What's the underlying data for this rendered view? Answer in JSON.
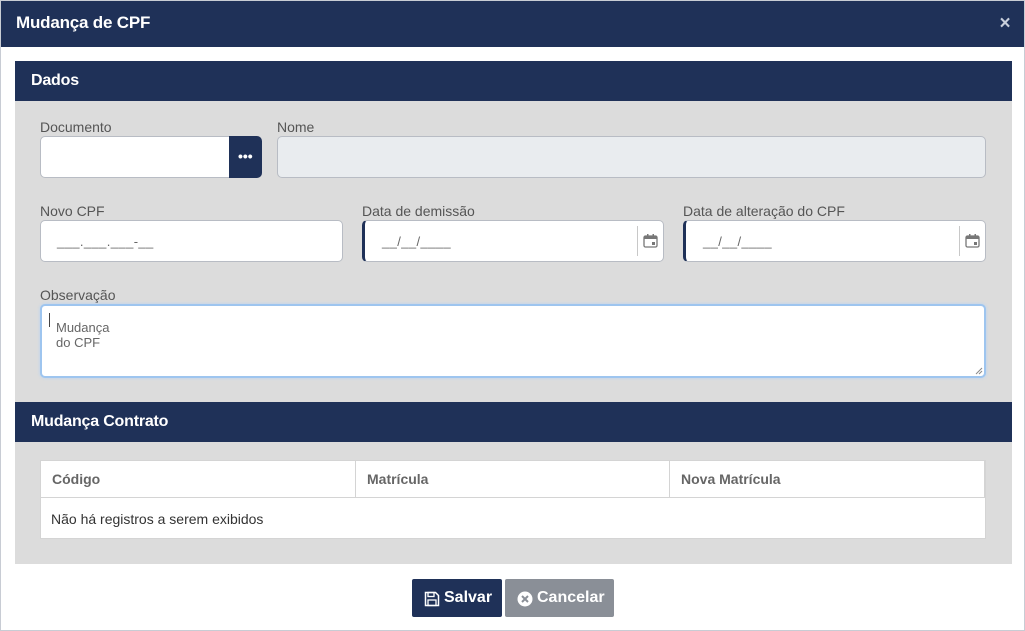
{
  "modal": {
    "title": "Mudança de CPF",
    "close_label": "×"
  },
  "sections": {
    "dados": "Dados",
    "mudanca_contrato": "Mudança Contrato"
  },
  "fields": {
    "documento": {
      "label": "Documento",
      "value": "",
      "search_button": "•••"
    },
    "nome": {
      "label": "Nome",
      "value": ""
    },
    "novo_cpf": {
      "label": "Novo CPF",
      "placeholder": "___.___.___-__"
    },
    "data_demissao": {
      "label": "Data de demissão",
      "placeholder": "__/__/____",
      "icon": "calendar-icon"
    },
    "data_alteracao": {
      "label": "Data de alteração do CPF",
      "placeholder": "__/__/____",
      "icon": "calendar-icon"
    },
    "observacao": {
      "label": "Observação",
      "value": "Mudança do CPF"
    }
  },
  "table": {
    "columns": [
      "Código",
      "Matrícula",
      "Nova Matrícula"
    ],
    "empty_message": "Não há registros a serem exibidos"
  },
  "buttons": {
    "save": {
      "label": "Salvar",
      "icon": "save-icon"
    },
    "cancel": {
      "label": "Cancelar",
      "icon": "cancel-circle-icon"
    }
  },
  "colors": {
    "header": "#1f3158",
    "section_body": "#dcdcdc",
    "cancel": "#8a8f97",
    "focus": "#9ec5ef"
  }
}
